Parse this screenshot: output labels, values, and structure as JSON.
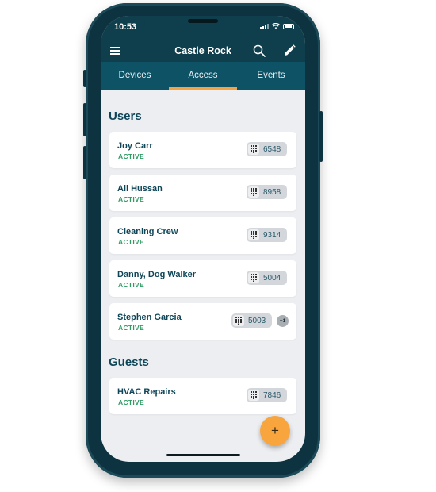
{
  "status_bar": {
    "time": "10:53"
  },
  "app_bar": {
    "title": "Castle Rock",
    "icons": [
      "menu-icon",
      "search-icon",
      "edit-icon"
    ]
  },
  "tabs": [
    {
      "label": "Devices",
      "active": false
    },
    {
      "label": "Access",
      "active": true
    },
    {
      "label": "Events",
      "active": false
    }
  ],
  "users": {
    "title": "Users",
    "items": [
      {
        "name": "Joy Carr",
        "status": "ACTIVE",
        "code": "6548"
      },
      {
        "name": "Ali Hussan",
        "status": "ACTIVE",
        "code": "8958"
      },
      {
        "name": "Cleaning Crew",
        "status": "ACTIVE",
        "code": "9314"
      },
      {
        "name": "Danny, Dog Walker",
        "status": "ACTIVE",
        "code": "5004"
      },
      {
        "name": "Stephen Garcia",
        "status": "ACTIVE",
        "code": "5003",
        "extra": "+1"
      }
    ]
  },
  "guests": {
    "title": "Guests",
    "items": [
      {
        "name": "HVAC Repairs",
        "status": "ACTIVE",
        "code": "7846"
      }
    ]
  },
  "fab": {
    "label": "+"
  },
  "colors": {
    "header": "#0f3e4c",
    "tabs": "#0e5266",
    "accent": "#f5a340",
    "active_status": "#2e9b63",
    "title_text": "#0e4658"
  }
}
